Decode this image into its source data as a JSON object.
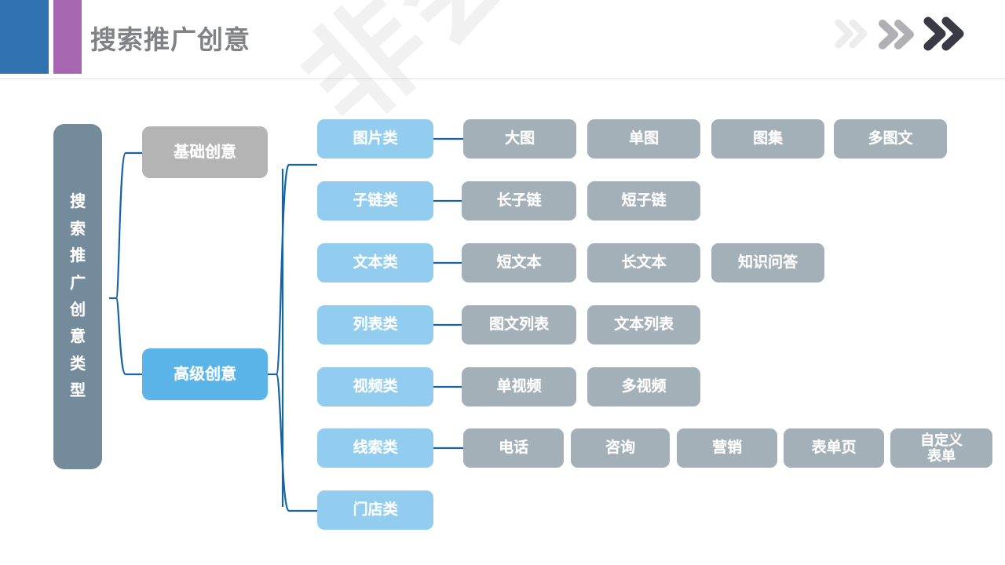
{
  "header": {
    "title": "搜索推广创意",
    "accent_blue": "#3172b0",
    "accent_purple": "#a666b0",
    "title_color": "#808285",
    "chevrons": [
      {
        "name": "chevron-double-right-light",
        "color": "#ececec"
      },
      {
        "name": "chevron-double-right-mid",
        "color": "#b0b0b4"
      },
      {
        "name": "chevron-double-right-dark",
        "color": "#3a3a44"
      }
    ]
  },
  "watermark": {
    "text": "非会员水印"
  },
  "colors": {
    "root": "#738b9a",
    "basic": "#b4b4b4",
    "advanced": "#5bb4e8",
    "category": "#92cdf0",
    "leaf": "#a4b0b8",
    "connector": "#1763a8"
  },
  "diagram": {
    "root": {
      "label": "搜索推广创意类型",
      "chars": [
        "搜",
        "索",
        "推",
        "广",
        "创",
        "意",
        "类",
        "型"
      ]
    },
    "level2": [
      {
        "label": "基础创意",
        "style": "basic"
      },
      {
        "label": "高级创意",
        "style": "advanced"
      }
    ],
    "rows": [
      {
        "category": "图片类",
        "leaves": [
          "大图",
          "单图",
          "图集",
          "多图文"
        ]
      },
      {
        "category": "子链类",
        "leaves": [
          "长子链",
          "短子链"
        ]
      },
      {
        "category": "文本类",
        "leaves": [
          "短文本",
          "长文本",
          "知识问答"
        ]
      },
      {
        "category": "列表类",
        "leaves": [
          "图文列表",
          "文本列表"
        ]
      },
      {
        "category": "视频类",
        "leaves": [
          "单视频",
          "多视频"
        ]
      },
      {
        "category": "线索类",
        "leaves": [
          "电话",
          "咨询",
          "营销",
          "表单页",
          "自定义\n表单"
        ]
      },
      {
        "category": "门店类",
        "leaves": []
      }
    ]
  }
}
